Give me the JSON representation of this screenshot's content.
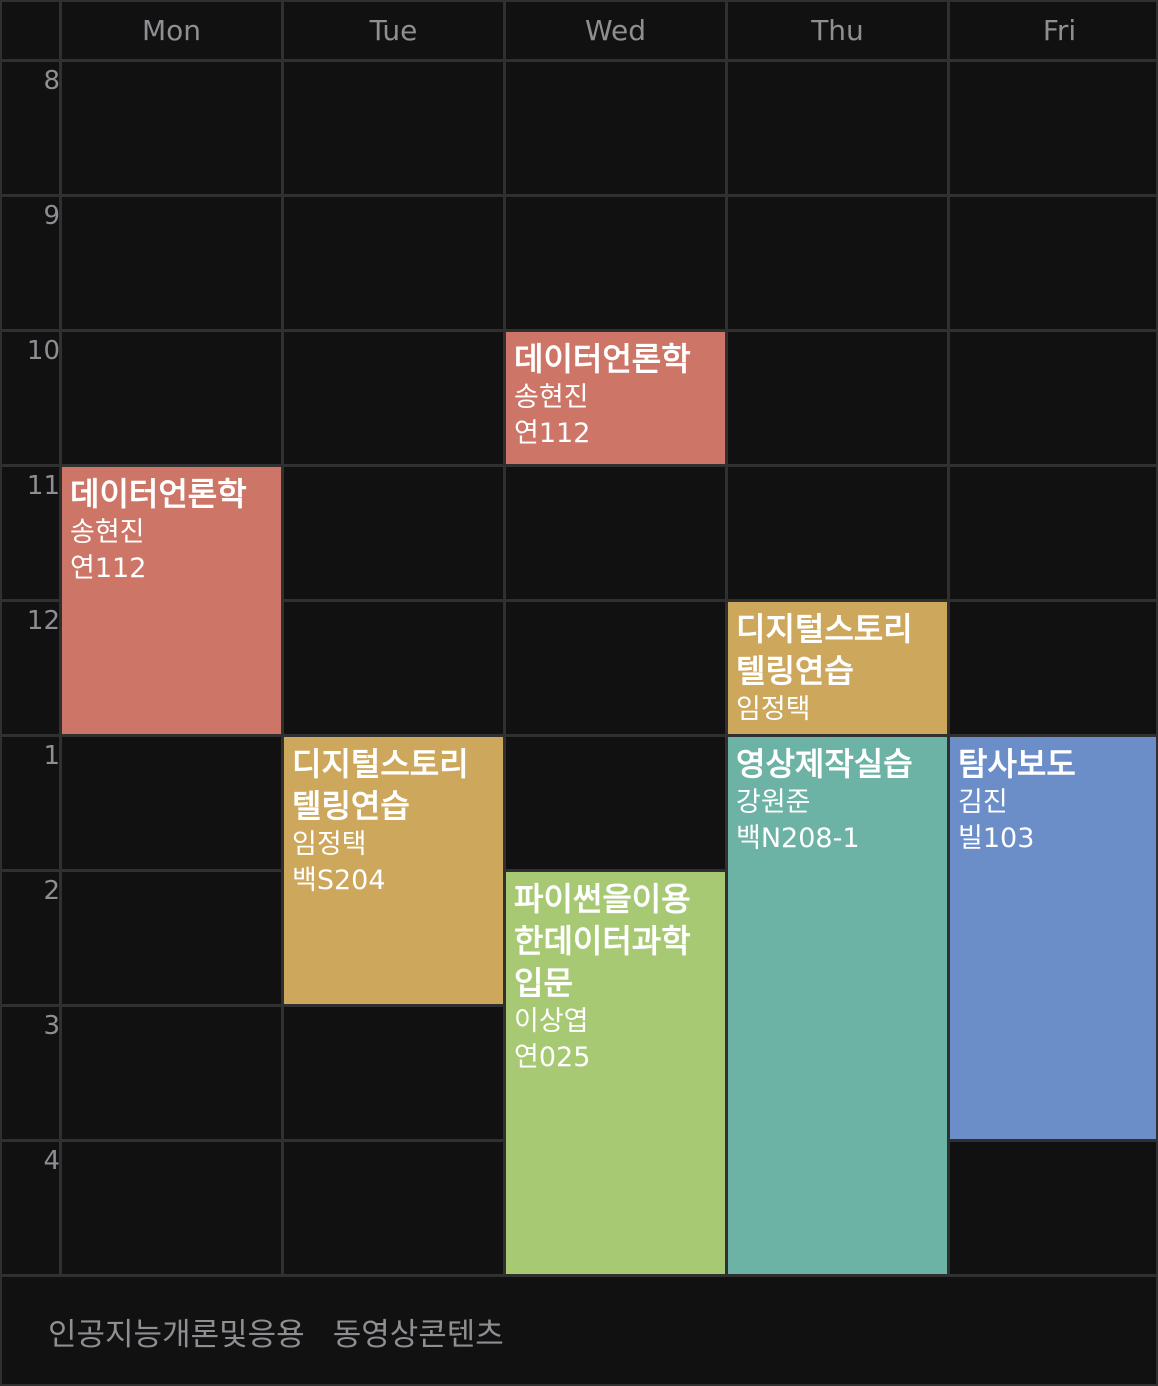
{
  "days": [
    "Mon",
    "Tue",
    "Wed",
    "Thu",
    "Fri"
  ],
  "hours": [
    "8",
    "9",
    "10",
    "11",
    "12",
    "1",
    "2",
    "3",
    "4"
  ],
  "colors": {
    "background": "#111111",
    "grid": "#303030",
    "muted_text": "#8e8e93"
  },
  "courses": [
    {
      "title": "데이터언론학",
      "professor": "송현진",
      "room": "연112",
      "day": 2,
      "start": 10,
      "end": 11,
      "color": "#cd7566"
    },
    {
      "title": "데이터언론학",
      "professor": "송현진",
      "room": "연112",
      "day": 0,
      "start": 11,
      "end": 13,
      "color": "#cd7566"
    },
    {
      "title": "디지털스토리텔링연습",
      "professor": "임정택",
      "room": "",
      "day": 3,
      "start": 12,
      "end": 13,
      "color": "#cca75c"
    },
    {
      "title": "디지털스토리텔링연습",
      "professor": "임정택",
      "room": "백S204",
      "day": 1,
      "start": 13,
      "end": 15,
      "color": "#cca75c"
    },
    {
      "title": "영상제작실습",
      "professor": "강원준",
      "room": "백N208-1",
      "day": 3,
      "start": 13,
      "end": 17,
      "color": "#6cb3a6"
    },
    {
      "title": "탐사보도",
      "professor": "김진",
      "room": "빌103",
      "day": 4,
      "start": 13,
      "end": 16,
      "color": "#6b8ec8"
    },
    {
      "title": "파이썬을이용한데이터과학입문",
      "professor": "이상엽",
      "room": "연025",
      "day": 2,
      "start": 14,
      "end": 17,
      "color": "#a7c974"
    }
  ],
  "unscheduled": [
    "인공지능개론및응용",
    "동영상콘텐츠"
  ]
}
